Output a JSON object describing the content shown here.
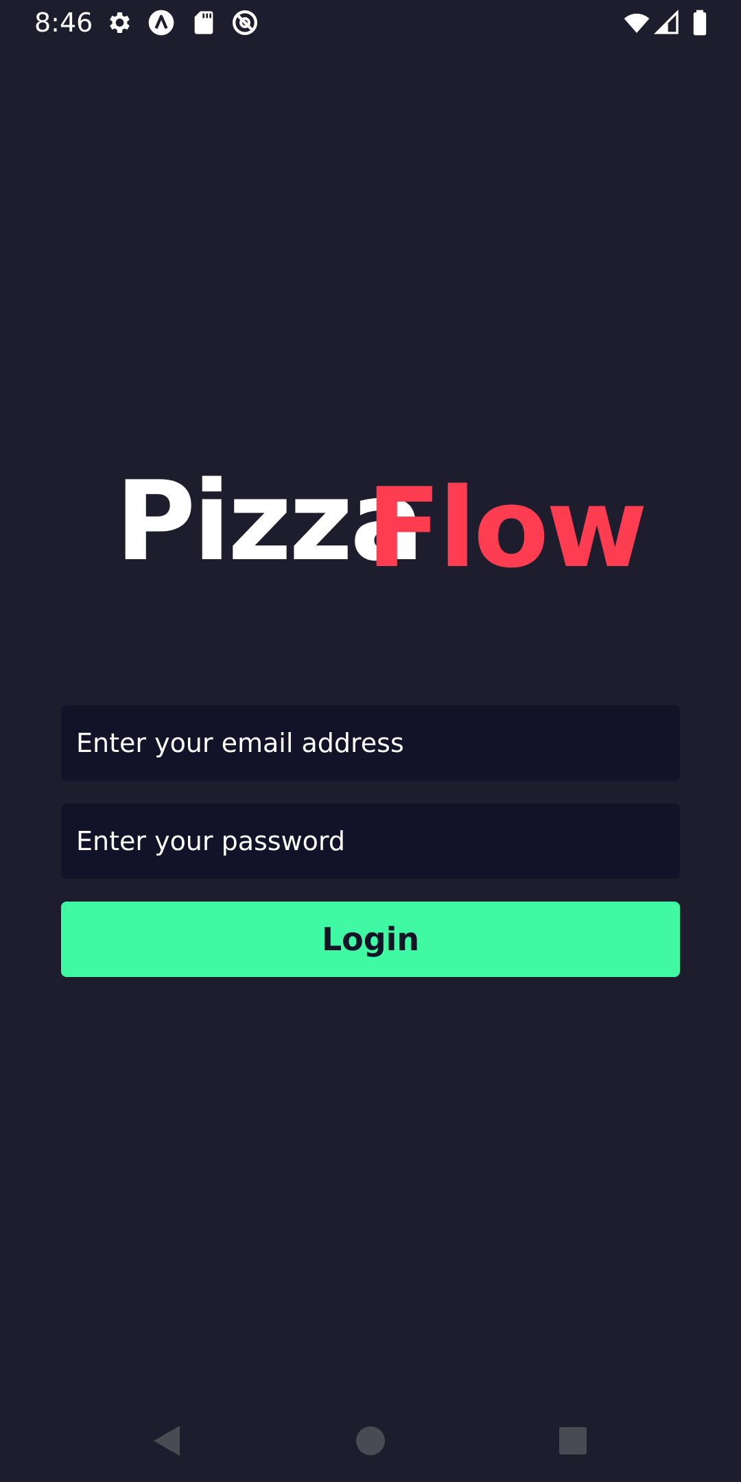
{
  "status_bar": {
    "time": "8:46",
    "left_icons": [
      "gear-icon",
      "app-a-icon",
      "sd-card-icon",
      "no-tracking-icon"
    ],
    "right_icons": [
      "wifi-icon",
      "signal-icon",
      "battery-icon"
    ]
  },
  "logo": {
    "part1": "Pizza",
    "part2": "Flow",
    "part1_color": "#ffffff",
    "part2_color": "#ff3d51"
  },
  "form": {
    "email_placeholder": "Enter your email address",
    "password_placeholder": "Enter your password",
    "login_label": "Login"
  },
  "colors": {
    "background": "#1e1d2d",
    "field_background": "#121228",
    "accent": "#40f9a3"
  },
  "nav_bar": {
    "icons": [
      "back-icon",
      "home-icon",
      "recents-icon"
    ]
  }
}
